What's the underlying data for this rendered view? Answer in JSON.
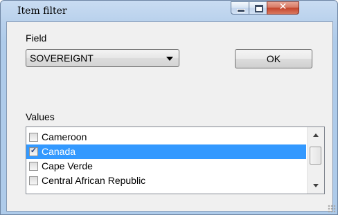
{
  "window": {
    "title": "Item filter",
    "controls": {
      "minimize_icon": "minimize-icon",
      "maximize_icon": "maximize-icon",
      "close_icon": "close-icon",
      "close_glyph": "✕"
    }
  },
  "field": {
    "label": "Field",
    "selected_value": "SOVEREIGNT",
    "dropdown_icon": "chevron-down-icon"
  },
  "ok_button": {
    "label": "OK"
  },
  "values": {
    "label": "Values",
    "items": [
      {
        "label": "Cameroon",
        "checked": false,
        "selected": false
      },
      {
        "label": "Canada",
        "checked": true,
        "selected": true
      },
      {
        "label": "Cape Verde",
        "checked": false,
        "selected": false
      },
      {
        "label": "Central African Republic",
        "checked": false,
        "selected": false
      }
    ],
    "check_glyph": "✓"
  },
  "colors": {
    "selection": "#3399ff",
    "titlebar": "#b9d1ec",
    "close_button": "#c4442b"
  }
}
